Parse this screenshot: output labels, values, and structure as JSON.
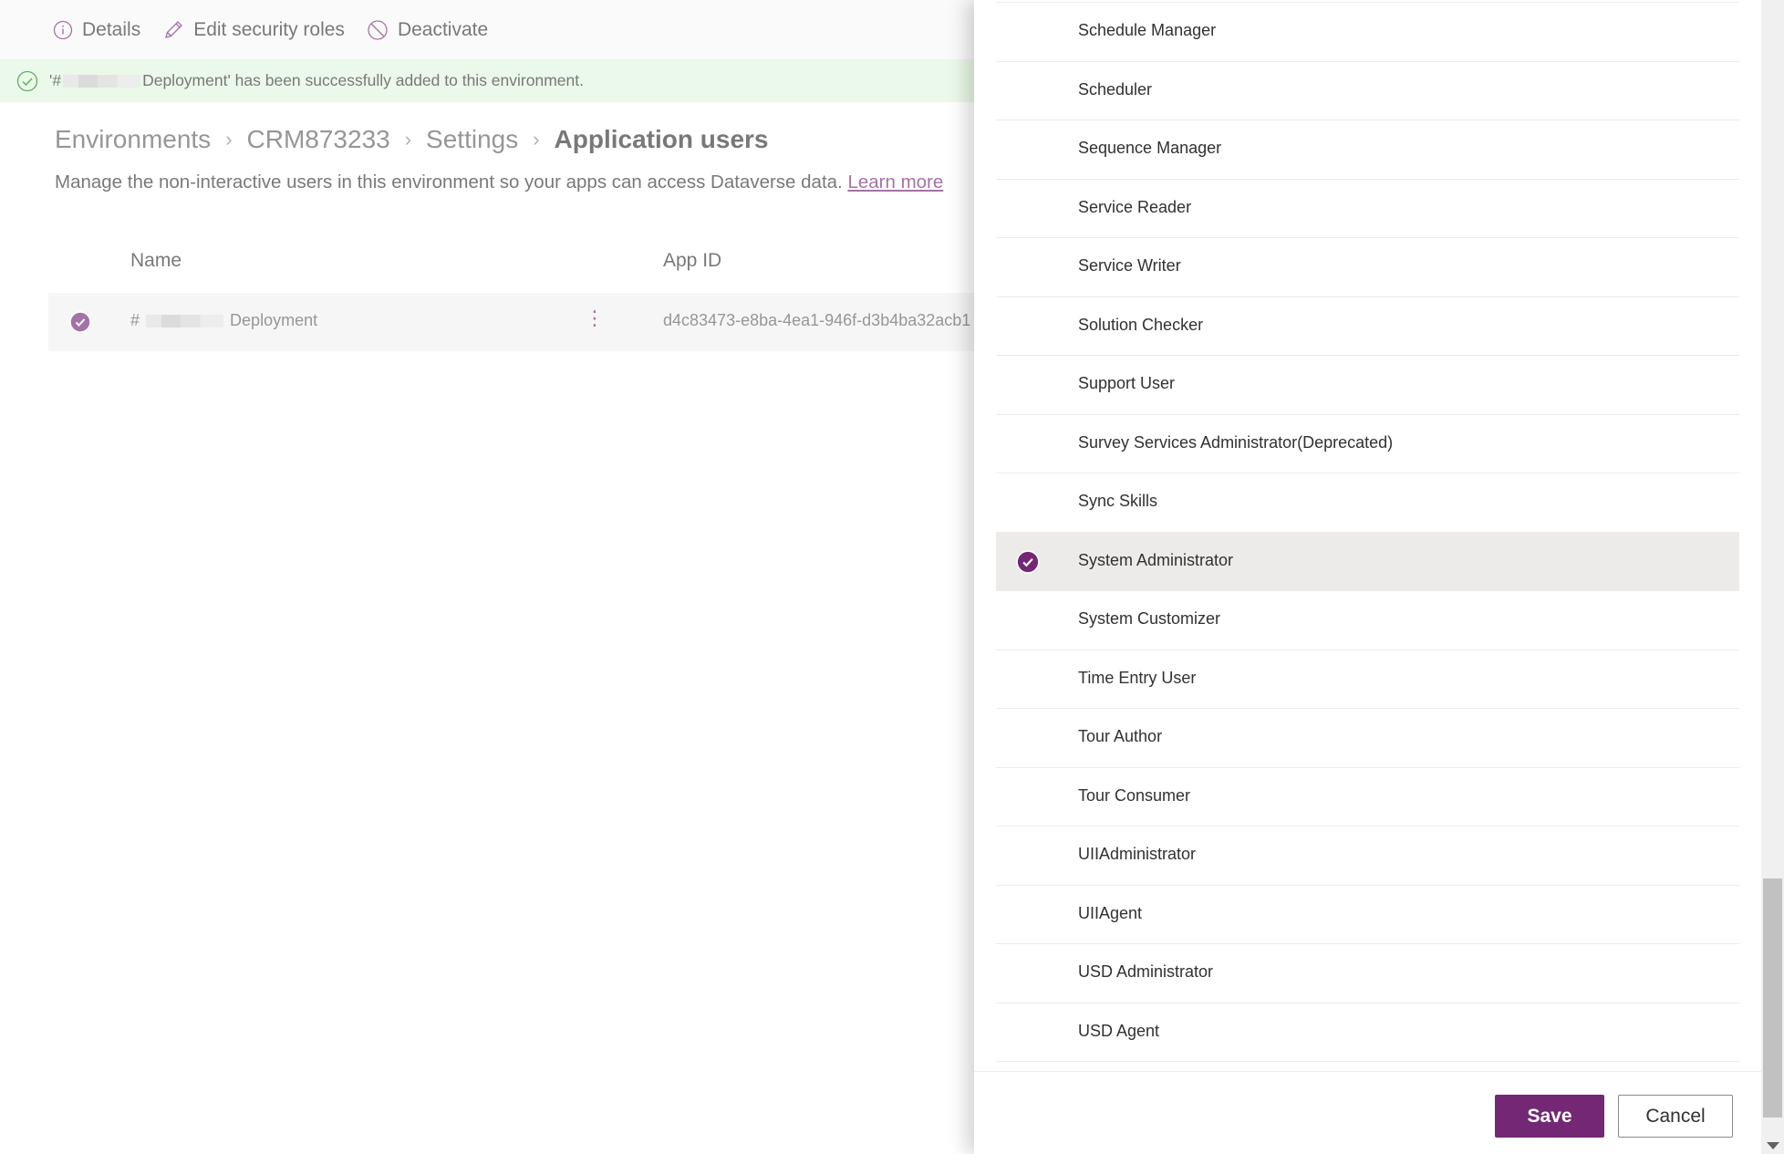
{
  "toolbar": {
    "details": "Details",
    "edit_roles": "Edit security roles",
    "deactivate": "Deactivate"
  },
  "notification": {
    "prefix": "'#",
    "suffix": "Deployment' has been successfully added to this environment."
  },
  "breadcrumb": [
    "Environments",
    "CRM873233",
    "Settings",
    "Application users"
  ],
  "description": {
    "text": "Manage the non-interactive users in this environment so your apps can access Dataverse data.",
    "link": "Learn more"
  },
  "table": {
    "headers": {
      "name": "Name",
      "app_id": "App ID"
    },
    "rows": [
      {
        "name_prefix": "#",
        "name_suffix": "Deployment",
        "app_id": "d4c83473-e8ba-4ea1-946f-d3b4ba32acb1",
        "selected": true
      }
    ]
  },
  "panel": {
    "roles": [
      {
        "label": "Schedule Manager",
        "selected": false
      },
      {
        "label": "Scheduler",
        "selected": false
      },
      {
        "label": "Sequence Manager",
        "selected": false
      },
      {
        "label": "Service Reader",
        "selected": false
      },
      {
        "label": "Service Writer",
        "selected": false
      },
      {
        "label": "Solution Checker",
        "selected": false
      },
      {
        "label": "Support User",
        "selected": false
      },
      {
        "label": "Survey Services Administrator(Deprecated)",
        "selected": false
      },
      {
        "label": "Sync Skills",
        "selected": false
      },
      {
        "label": "System Administrator",
        "selected": true
      },
      {
        "label": "System Customizer",
        "selected": false
      },
      {
        "label": "Time Entry User",
        "selected": false
      },
      {
        "label": "Tour Author",
        "selected": false
      },
      {
        "label": "Tour Consumer",
        "selected": false
      },
      {
        "label": "UIIAdministrator",
        "selected": false
      },
      {
        "label": "UIIAgent",
        "selected": false
      },
      {
        "label": "USD Administrator",
        "selected": false
      },
      {
        "label": "USD Agent",
        "selected": false
      }
    ],
    "save": "Save",
    "cancel": "Cancel"
  },
  "colors": {
    "accent": "#742774",
    "success_bg": "#dff6dd",
    "success_icon": "#107c10",
    "selected_row": "#edebe9"
  }
}
